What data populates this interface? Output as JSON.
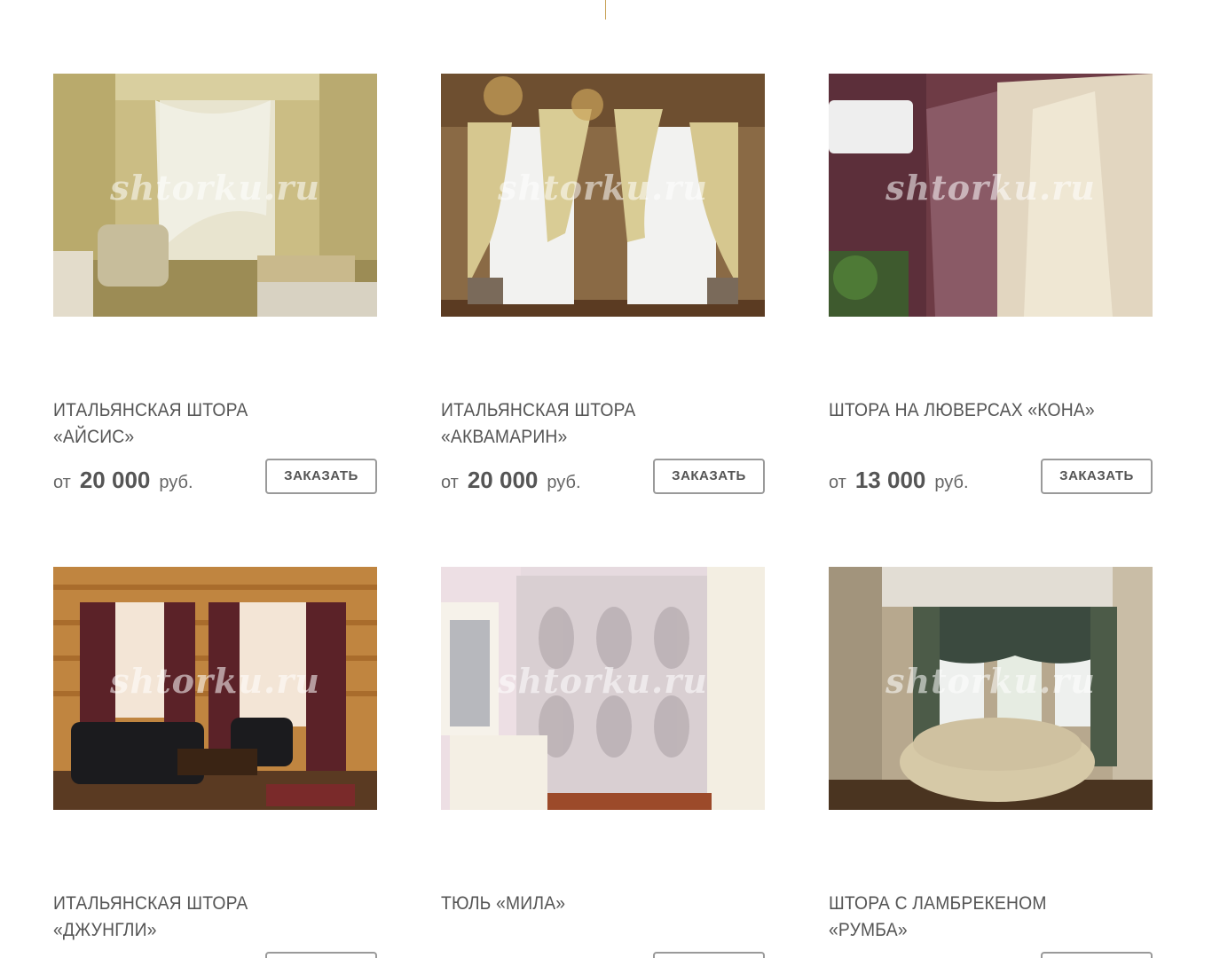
{
  "watermark": "shtorku.ru",
  "price_prefix": "от",
  "price_currency": "руб.",
  "order_label": "ЗАКАЗАТЬ",
  "products": [
    {
      "title": "ИТАЛЬЯНСКАЯ ШТОРА «АЙСИС»",
      "price": "20 000",
      "photo": "bedroom-sheer-curtain-photo"
    },
    {
      "title": "ИТАЛЬЯНСКАЯ ШТОРА «АКВАМАРИН»",
      "price": "20 000",
      "photo": "arched-windows-curtains-photo"
    },
    {
      "title": "ШТОРА НА ЛЮВЕРСАХ «КОНА»",
      "price": "13 000",
      "photo": "eyelet-curtain-photo"
    },
    {
      "title": "ИТАЛЬЯНСКАЯ ШТОРА «ДЖУНГЛИ»",
      "price": "",
      "photo": "log-cabin-living-room-photo"
    },
    {
      "title": "ТЮЛЬ «МИЛА»",
      "price": "",
      "photo": "lace-tulle-bedroom-photo"
    },
    {
      "title": "ШТОРА С ЛАМБРЕКЕНОМ «РУМБА»",
      "price": "",
      "photo": "round-bed-lambrequin-photo"
    }
  ]
}
